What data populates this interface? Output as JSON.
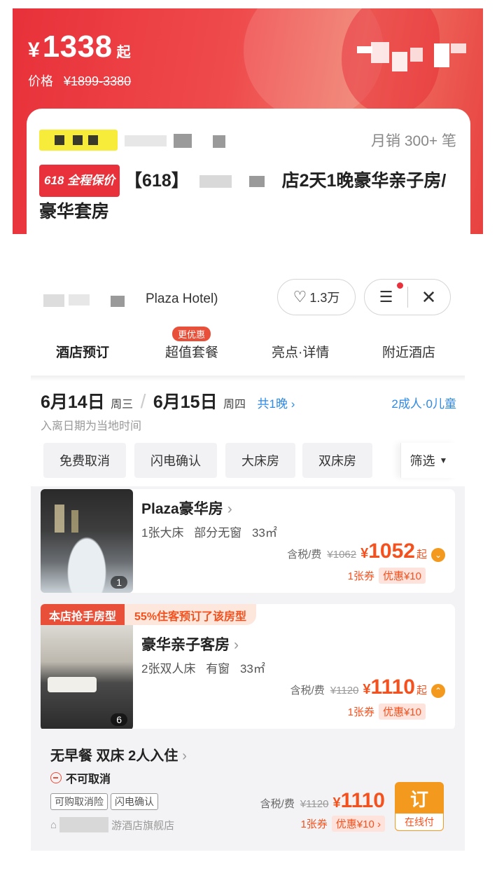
{
  "banner": {
    "price_symbol": "¥",
    "price": "1338",
    "price_suffix": "起",
    "price_label": "价格",
    "price_range": "¥1899-3380"
  },
  "product": {
    "monthly_sales": "月销 300+ 笔",
    "badge": "618 全程保价",
    "title_prefix": "【618】",
    "title_suffix": "店2天1晚豪华亲子房/豪华套房"
  },
  "hotel": {
    "name_visible": "Plaza Hotel)",
    "favorite_count": "1.3万",
    "favorite_icon": "heart-plus-icon",
    "menu_icon": "list-icon",
    "close_icon": "close-icon"
  },
  "tabs": [
    {
      "label": "酒店预订",
      "active": true
    },
    {
      "label": "超值套餐",
      "badge": "更优惠"
    },
    {
      "label": "亮点·详情"
    },
    {
      "label": "附近酒店"
    }
  ],
  "dates": {
    "checkin_date": "6月14日",
    "checkin_week": "周三",
    "checkout_date": "6月15日",
    "checkout_week": "周四",
    "nights": "共1晚 ›",
    "guests": "2成人·0儿童",
    "note": "入离日期为当地时间"
  },
  "filters": [
    "免费取消",
    "闪电确认",
    "大床房",
    "双床房"
  ],
  "filter_button": "筛选",
  "rooms": [
    {
      "name": "Plaza豪华房",
      "specs": [
        "1张大床",
        "部分无窗",
        "33㎡"
      ],
      "photo_count": "1",
      "tax_label": "含税/费",
      "old_price": "¥1062",
      "currency": "¥",
      "price": "1052",
      "price_suffix": "起",
      "coupon_count": "1张券",
      "discount": "优惠¥10"
    },
    {
      "ribbon": "本店抢手房型",
      "ribbon_note": "55%住客预订了该房型",
      "name": "豪华亲子客房",
      "specs": [
        "2张双人床",
        "有窗",
        "33㎡"
      ],
      "photo_count": "6",
      "tax_label": "含税/费",
      "old_price": "¥1120",
      "currency": "¥",
      "price": "1110",
      "price_suffix": "起",
      "coupon_count": "1张券",
      "discount": "优惠¥10"
    }
  ],
  "rate_plan": {
    "title": "无早餐 双床 2人入住",
    "cancel_policy": "不可取消",
    "tags": [
      "可购取消险",
      "闪电确认"
    ],
    "shop_suffix": "游酒店旗舰店",
    "tax_label": "含税/费",
    "old_price": "¥1120",
    "currency": "¥",
    "price": "1110",
    "coupon_count": "1张券",
    "discount": "优惠¥10 ›",
    "book_label": "订",
    "pay_label": "在线付"
  },
  "colors": {
    "brand_red": "#e8313a",
    "price_orange": "#f5511e",
    "link_blue": "#2e8ae6",
    "highlight_yellow": "#f7e24a"
  }
}
